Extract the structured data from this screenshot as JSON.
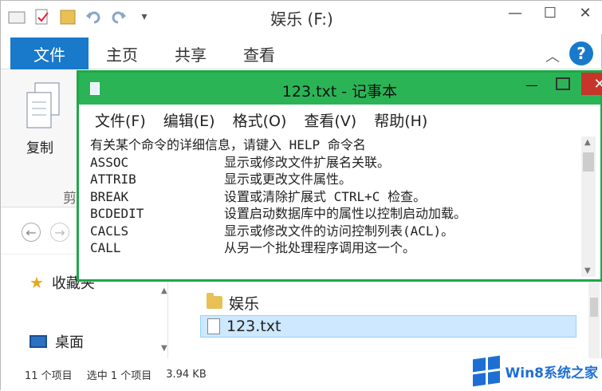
{
  "explorer": {
    "title": "娱乐 (F:)",
    "tabs": {
      "file": "文件",
      "home": "主页",
      "share": "共享",
      "view": "查看"
    },
    "help": "?",
    "ribbon": {
      "copy": "复制",
      "clipboard": "剪"
    },
    "sidebar": {
      "favorites": "收藏夹",
      "desktop": "桌面"
    },
    "files": [
      {
        "name": "娱乐",
        "icon": "folder-icon"
      },
      {
        "name": "123.txt",
        "icon": "text-file-icon"
      }
    ],
    "status": {
      "count": "11 个项目",
      "selected": "选中 1 个项目",
      "size": "3.94 KB"
    }
  },
  "notepad": {
    "title": "123.txt - 记事本",
    "menu": [
      "文件(F)",
      "编辑(E)",
      "格式(O)",
      "查看(V)",
      "帮助(H)"
    ],
    "lines": [
      {
        "cmd": "有关某个命令的详细信息，请键入 HELP 命令名",
        "desc": ""
      },
      {
        "cmd": "ASSOC",
        "desc": "显示或修改文件扩展名关联。"
      },
      {
        "cmd": "ATTRIB",
        "desc": "显示或更改文件属性。"
      },
      {
        "cmd": "BREAK",
        "desc": "设置或清除扩展式 CTRL+C 检查。"
      },
      {
        "cmd": "BCDEDIT",
        "desc": "设置启动数据库中的属性以控制启动加载。"
      },
      {
        "cmd": "CACLS",
        "desc": "显示或修改文件的访问控制列表(ACL)。"
      },
      {
        "cmd": "CALL",
        "desc": "从另一个批处理程序调用这一个。"
      }
    ]
  },
  "watermark": "Win8系统之家",
  "colors": {
    "accent": "#1979ca",
    "notepad_border": "#1ea84a",
    "close": "#c7342a"
  }
}
